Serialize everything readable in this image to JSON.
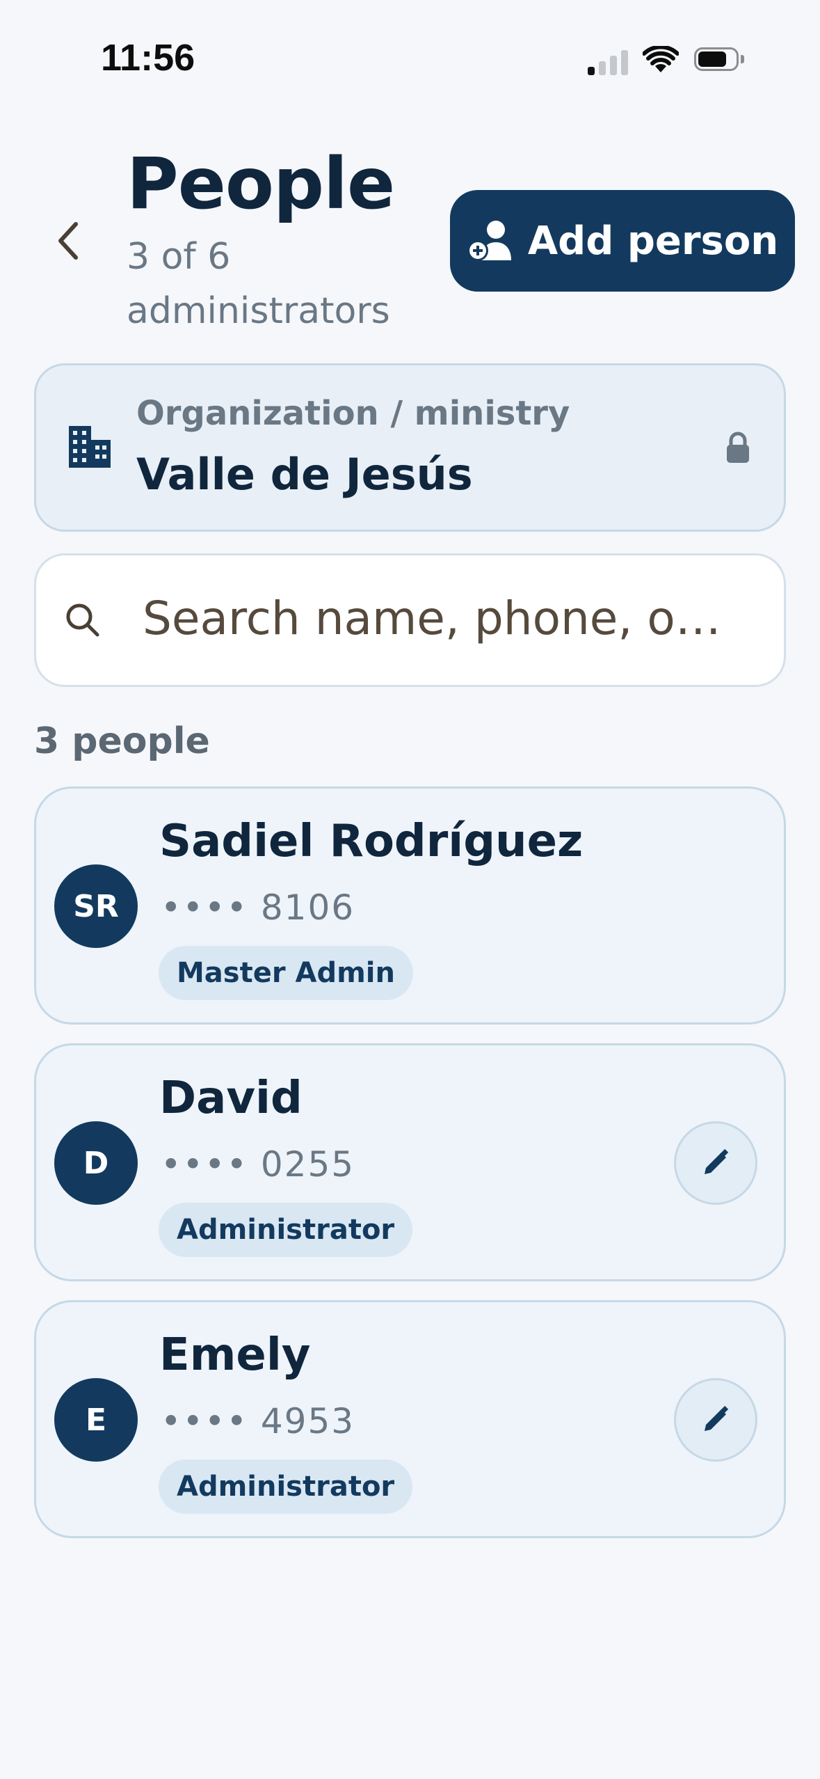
{
  "status_bar": {
    "time": "11:56"
  },
  "header": {
    "title": "People",
    "subtitle": "3 of 6 administrators",
    "add_button_label": "Add person"
  },
  "organization": {
    "label": "Organization / ministry",
    "value": "Valle de Jesús"
  },
  "search": {
    "placeholder": "Search name, phone, o…"
  },
  "list": {
    "count_label": "3 people",
    "people": [
      {
        "initials": "SR",
        "name": "Sadiel Rodríguez",
        "phone": "•••• 8106",
        "role": "Master Admin",
        "editable": false
      },
      {
        "initials": "D",
        "name": "David",
        "phone": "•••• 0255",
        "role": "Administrator",
        "editable": true
      },
      {
        "initials": "E",
        "name": "Emely",
        "phone": "•••• 4953",
        "role": "Administrator",
        "editable": true
      }
    ]
  },
  "colors": {
    "primary": "#133a5e",
    "background": "#f5f7fa",
    "card": "#eef4fa",
    "muted_text": "#6a7784"
  },
  "icons": {
    "back": "chevron-left-icon",
    "add": "add-person-icon",
    "org": "building-icon",
    "lock": "lock-icon",
    "search": "search-icon",
    "edit": "pencil-icon"
  }
}
